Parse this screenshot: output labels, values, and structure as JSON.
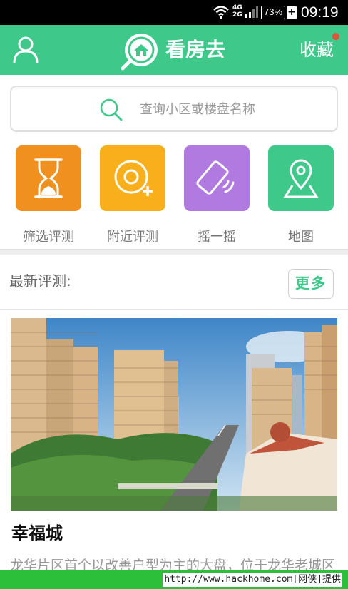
{
  "status_bar": {
    "network_top": "4G",
    "network_bottom": "2G",
    "battery": "73%",
    "charge_symbol": "+",
    "time": "09:19"
  },
  "header": {
    "title": "看房去",
    "favorites_label": "收藏",
    "notification_dot_color": "#e84f3c",
    "brand_color": "#3ec88a"
  },
  "search": {
    "placeholder": "查询小区或楼盘名称"
  },
  "menu": {
    "items": [
      {
        "label": "筛选评测",
        "icon": "hourglass-icon",
        "color": "#f0901e"
      },
      {
        "label": "附近评测",
        "icon": "location-target-icon",
        "color": "#f9ae1b"
      },
      {
        "label": "摇一摇",
        "icon": "shake-phone-icon",
        "color": "#b07ae0"
      },
      {
        "label": "地图",
        "icon": "map-pin-icon",
        "color": "#3ec88a"
      }
    ]
  },
  "latest": {
    "heading": "最新评测:",
    "more_label": "更多",
    "card": {
      "name": "幸福城",
      "description": "龙华片区首个以改善户型为主的大盘，位于龙华老城区"
    }
  },
  "watermark": {
    "text": "http://www.hackhome.com[网侠]提供"
  }
}
